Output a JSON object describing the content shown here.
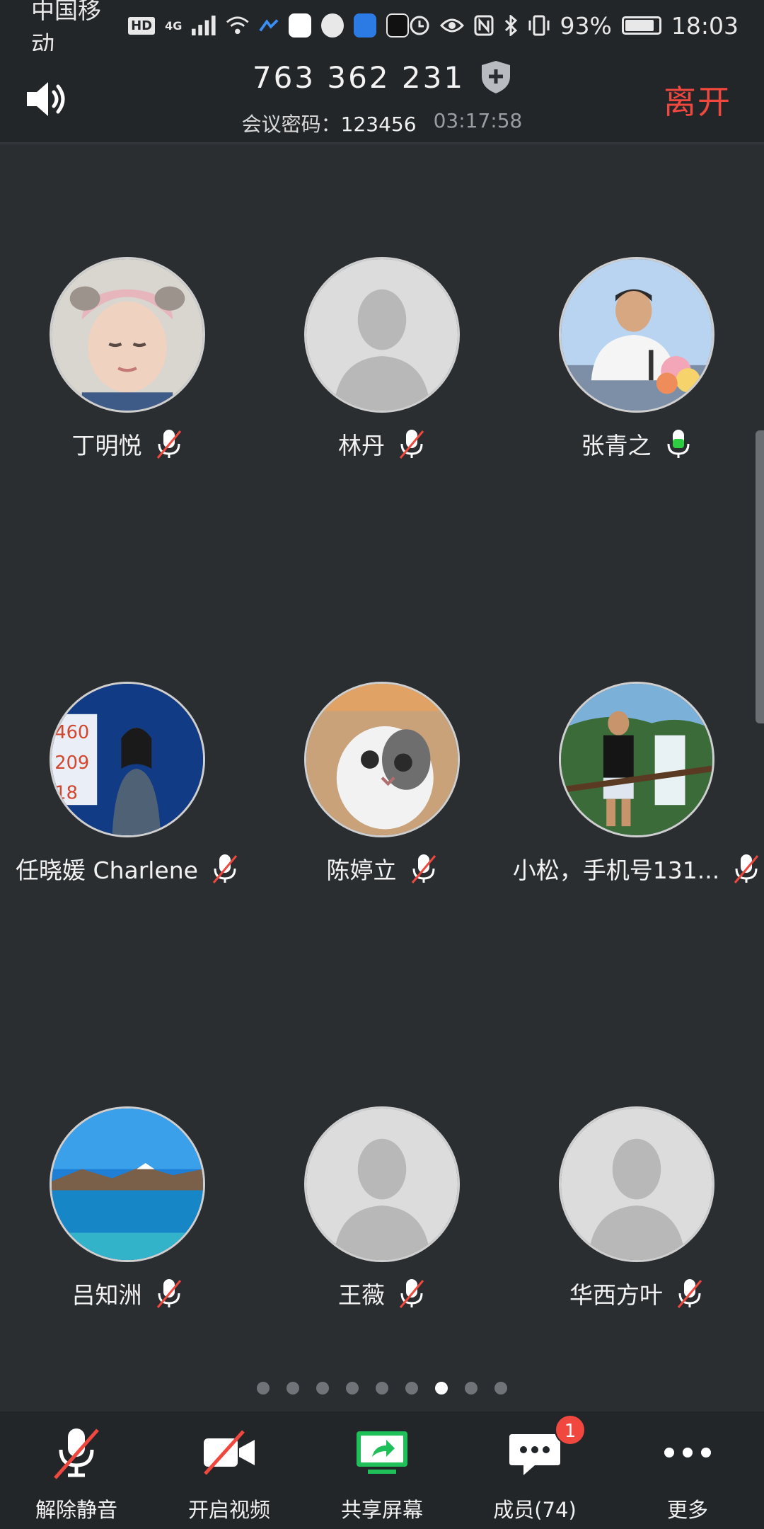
{
  "status_bar": {
    "carrier": "中国移动",
    "hd": "HD",
    "network": "4G",
    "battery": "93%",
    "time": "18:03"
  },
  "header": {
    "meeting_id": "763 362 231",
    "password_label": "会议密码：",
    "password": "123456",
    "duration": "03:17:58",
    "leave_label": "离开"
  },
  "participants": [
    {
      "name": "丁明悦",
      "mic": "muted",
      "avatar": "child-photo"
    },
    {
      "name": "林丹",
      "mic": "muted",
      "avatar": "default-avatar"
    },
    {
      "name": "张青之",
      "mic": "active",
      "avatar": "speaker-photo"
    },
    {
      "name": "任晓媛 Charlene",
      "mic": "muted",
      "avatar": "stage-photo"
    },
    {
      "name": "陈婷立",
      "mic": "muted",
      "avatar": "cat-photo"
    },
    {
      "name": "小松，手机号131...",
      "mic": "muted",
      "avatar": "waterfall-photo"
    },
    {
      "name": "吕知洲",
      "mic": "muted",
      "avatar": "lake-photo"
    },
    {
      "name": "王薇",
      "mic": "muted",
      "avatar": "default-avatar"
    },
    {
      "name": "华西方叶",
      "mic": "muted",
      "avatar": "default-avatar"
    }
  ],
  "pager": {
    "total": 9,
    "active_index": 6
  },
  "toolbar": {
    "unmute_label": "解除静音",
    "video_label": "开启视频",
    "share_label": "共享屏幕",
    "members_label": "成员(74)",
    "members_badge": "1",
    "more_label": "更多"
  },
  "colors": {
    "background": "#2b2e31",
    "bar": "#232629",
    "leave": "#f0483e",
    "mic_active": "#2ecc40",
    "share_green": "#1fbf5a"
  }
}
